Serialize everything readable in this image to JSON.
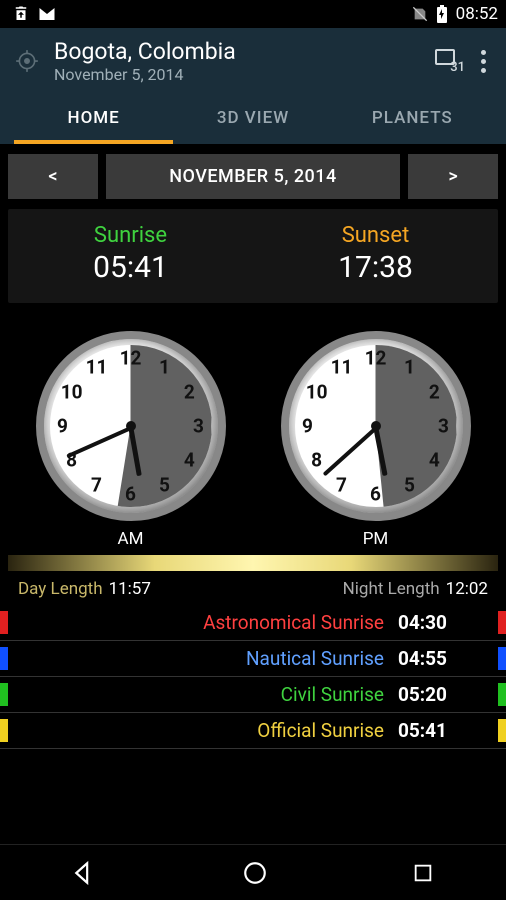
{
  "status": {
    "time": "08:52"
  },
  "header": {
    "city": "Bogota, Colombia",
    "date": "November 5, 2014",
    "calendar_day": "31"
  },
  "tabs": {
    "home": "HOME",
    "view3d": "3D VIEW",
    "planets": "PLANETS"
  },
  "date_nav": {
    "prev": "<",
    "label": "NOVEMBER 5, 2014",
    "next": ">"
  },
  "sun": {
    "sunrise_label": "Sunrise",
    "sunrise_time": "05:41",
    "sunset_label": "Sunset",
    "sunset_time": "17:38"
  },
  "clocks": {
    "am": "AM",
    "pm": "PM"
  },
  "lengths": {
    "day_label": "Day Length",
    "day_value": "11:57",
    "night_label": "Night Length",
    "night_value": "12:02"
  },
  "events": [
    {
      "label": "Astronomical Sunrise",
      "time": "04:30",
      "color": "red"
    },
    {
      "label": "Nautical Sunrise",
      "time": "04:55",
      "color": "blue"
    },
    {
      "label": "Civil Sunrise",
      "time": "05:20",
      "color": "green"
    },
    {
      "label": "Official Sunrise",
      "time": "05:41",
      "color": "yellow"
    }
  ]
}
